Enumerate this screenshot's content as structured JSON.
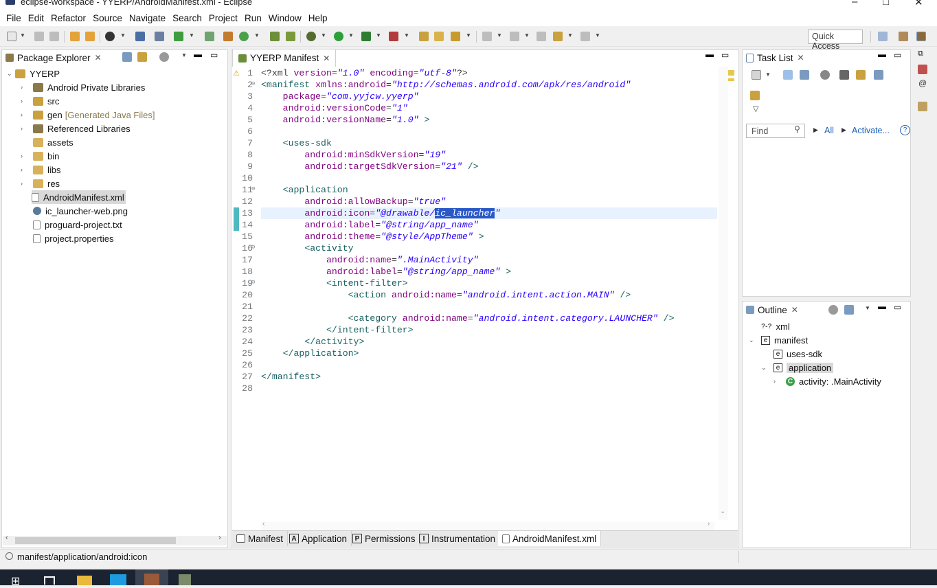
{
  "window": {
    "title": "eclipse-workspace - YYERP/AndroidManifest.xml - Eclipse",
    "min": "–",
    "max": "□",
    "close": "✕"
  },
  "menu": [
    "File",
    "Edit",
    "Refactor",
    "Source",
    "Navigate",
    "Search",
    "Project",
    "Run",
    "Window",
    "Help"
  ],
  "toolbar": {
    "quick_access": "Quick Access"
  },
  "package_explorer": {
    "tab": "Package Explorer",
    "project": "YYERP",
    "items": [
      {
        "label": "Android Private Libraries",
        "suffix": "",
        "icon": "library-icon",
        "expandable": true
      },
      {
        "label": "src",
        "suffix": "",
        "icon": "package-folder-icon",
        "expandable": true
      },
      {
        "label": "gen",
        "suffix": "[Generated Java Files]",
        "icon": "package-folder-icon",
        "expandable": true
      },
      {
        "label": "Referenced Libraries",
        "suffix": "",
        "icon": "library-icon",
        "expandable": true
      },
      {
        "label": "assets",
        "suffix": "",
        "icon": "folder-icon",
        "expandable": false
      },
      {
        "label": "bin",
        "suffix": "",
        "icon": "folder-icon",
        "expandable": true
      },
      {
        "label": "libs",
        "suffix": "",
        "icon": "folder-icon",
        "expandable": true
      },
      {
        "label": "res",
        "suffix": "",
        "icon": "folder-icon",
        "expandable": true
      },
      {
        "label": "AndroidManifest.xml",
        "suffix": "",
        "icon": "xml-file-icon",
        "expandable": false,
        "selected": true
      },
      {
        "label": "ic_launcher-web.png",
        "suffix": "",
        "icon": "image-file-icon",
        "expandable": false
      },
      {
        "label": "proguard-project.txt",
        "suffix": "",
        "icon": "text-file-icon",
        "expandable": false
      },
      {
        "label": "project.properties",
        "suffix": "",
        "icon": "text-file-icon",
        "expandable": false
      }
    ]
  },
  "editor": {
    "tab": "YYERP Manifest",
    "lines": [
      {
        "n": "1",
        "html": "<span class='pi'>&lt;?xml </span><span class='attr'>version</span>=<span class='val'>\"1.0\"</span> <span class='attr'>encoding</span>=<span class='val'>\"utf-8\"</span><span class='pi'>?&gt;</span>"
      },
      {
        "n": "2",
        "html": "<span class='tag'>&lt;manifest</span> <span class='attr'>xmlns:android</span>=<span class='val'>\"http://schemas.android.com/apk/res/android\"</span>"
      },
      {
        "n": "3",
        "html": "    <span class='attr'>package</span>=<span class='val'>\"com.yyjcw.yyerp\"</span>"
      },
      {
        "n": "4",
        "html": "    <span class='attr'>android:versionCode</span>=<span class='val'>\"1\"</span>"
      },
      {
        "n": "5",
        "html": "    <span class='attr'>android:versionName</span>=<span class='val'>\"1.0\"</span> <span class='tag'>&gt;</span>"
      },
      {
        "n": "6",
        "html": ""
      },
      {
        "n": "7",
        "html": "    <span class='tag'>&lt;uses-sdk</span>"
      },
      {
        "n": "8",
        "html": "        <span class='attr'>android:minSdkVersion</span>=<span class='val'>\"19\"</span>"
      },
      {
        "n": "9",
        "html": "        <span class='attr'>android:targetSdkVersion</span>=<span class='val'>\"21\"</span> <span class='tag'>/&gt;</span>"
      },
      {
        "n": "10",
        "html": ""
      },
      {
        "n": "11",
        "html": "    <span class='tag'>&lt;application</span>"
      },
      {
        "n": "12",
        "html": "        <span class='attr'>android:allowBackup</span>=<span class='val'>\"true\"</span>"
      },
      {
        "n": "13",
        "html": "        <span class='attr'>android:icon</span>=<span class='val'>\"@drawable/<span style='background:#2a58c8;color:#fff'>ic_launcher</span>\"</span>"
      },
      {
        "n": "14",
        "html": "        <span class='attr'>android:label</span>=<span class='val'>\"@string/app_name\"</span>"
      },
      {
        "n": "15",
        "html": "        <span class='attr'>android:theme</span>=<span class='val'>\"@style/AppTheme\"</span> <span class='tag'>&gt;</span>"
      },
      {
        "n": "16",
        "html": "        <span class='tag'>&lt;activity</span>"
      },
      {
        "n": "17",
        "html": "            <span class='attr'>android:name</span>=<span class='val'>\".MainActivity\"</span>"
      },
      {
        "n": "18",
        "html": "            <span class='attr'>android:label</span>=<span class='val'>\"@string/app_name\"</span> <span class='tag'>&gt;</span>"
      },
      {
        "n": "19",
        "html": "            <span class='tag'>&lt;intent-filter&gt;</span>"
      },
      {
        "n": "20",
        "html": "                <span class='tag'>&lt;action</span> <span class='attr'>android:name</span>=<span class='val'>\"android.intent.action.MAIN\"</span> <span class='tag'>/&gt;</span>"
      },
      {
        "n": "21",
        "html": ""
      },
      {
        "n": "22",
        "html": "                <span class='tag'>&lt;category</span> <span class='attr'>android:name</span>=<span class='val'>\"android.intent.category.LAUNCHER\"</span> <span class='tag'>/&gt;</span>"
      },
      {
        "n": "23",
        "html": "            <span class='tag'>&lt;/intent-filter&gt;</span>"
      },
      {
        "n": "24",
        "html": "        <span class='tag'>&lt;/activity&gt;</span>"
      },
      {
        "n": "25",
        "html": "    <span class='tag'>&lt;/application&gt;</span>"
      },
      {
        "n": "26",
        "html": ""
      },
      {
        "n": "27",
        "html": "<span class='tag'>&lt;/manifest&gt;</span>"
      },
      {
        "n": "28",
        "html": ""
      }
    ],
    "bottom_tabs": [
      {
        "label": "Manifest",
        "badge": ""
      },
      {
        "label": "Application",
        "badge": "A"
      },
      {
        "label": "Permissions",
        "badge": "P"
      },
      {
        "label": "Instrumentation",
        "badge": "I"
      },
      {
        "label": "AndroidManifest.xml",
        "badge": ""
      }
    ]
  },
  "task_list": {
    "tab": "Task List",
    "find_placeholder": "Find",
    "all": "All",
    "activate": "Activate...",
    "help": "?"
  },
  "outline": {
    "tab": "Outline",
    "items": [
      {
        "label": "xml",
        "badge": "?-?",
        "level": 0,
        "twisty": ""
      },
      {
        "label": "manifest",
        "badge": "e",
        "level": 0,
        "twisty": "⌄"
      },
      {
        "label": "uses-sdk",
        "badge": "e",
        "level": 1,
        "twisty": ""
      },
      {
        "label": "application",
        "badge": "e",
        "level": 1,
        "twisty": "⌄",
        "selected": true
      },
      {
        "label": "activity: .MainActivity",
        "badge": "C",
        "level": 2,
        "twisty": "›"
      }
    ]
  },
  "status": {
    "path": "manifest/application/android:icon"
  }
}
